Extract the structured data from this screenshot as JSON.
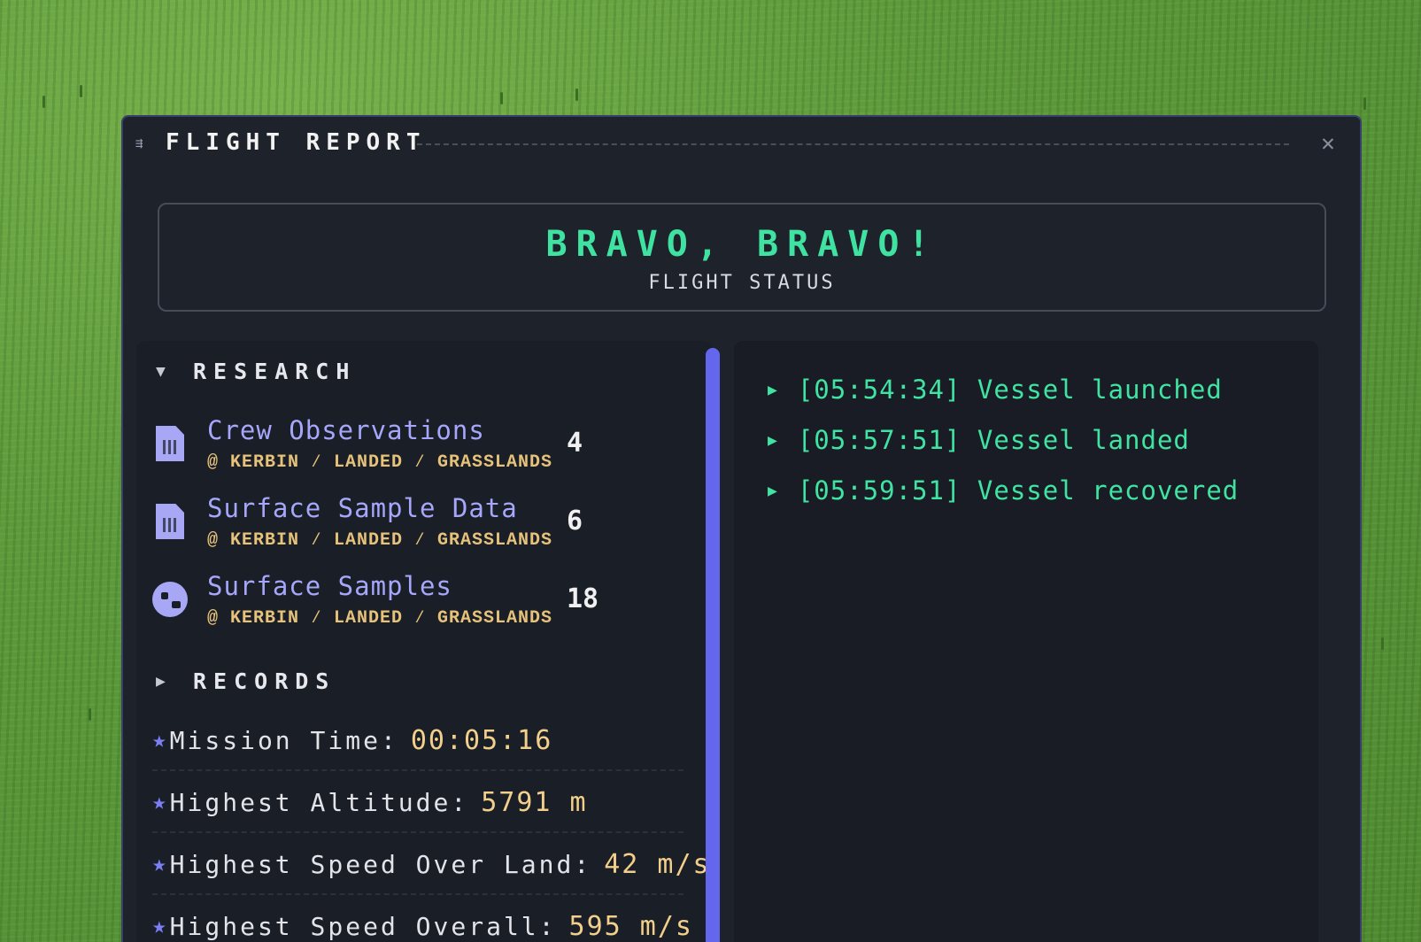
{
  "window": {
    "title": "FLIGHT REPORT"
  },
  "status": {
    "headline": "BRAVO, BRAVO!",
    "subtitle": "FLIGHT STATUS"
  },
  "research": {
    "heading": "RESEARCH",
    "items": [
      {
        "title": "Crew Observations",
        "location": "@ KERBIN ⁄ LANDED ⁄ GRASSLANDS",
        "count": "4",
        "icon": "document-icon"
      },
      {
        "title": "Surface Sample Data",
        "location": "@ KERBIN ⁄ LANDED ⁄ GRASSLANDS",
        "count": "6",
        "icon": "document-icon"
      },
      {
        "title": "Surface Samples",
        "location": "@ KERBIN ⁄ LANDED ⁄ GRASSLANDS",
        "count": "18",
        "icon": "rock-sample-icon"
      }
    ]
  },
  "records": {
    "heading": "RECORDS",
    "items": [
      {
        "label": "Mission Time:",
        "value": "00:05:16"
      },
      {
        "label": "Highest Altitude:",
        "value": "5791 m"
      },
      {
        "label": "Highest Speed Over Land:",
        "value": "42 m/s"
      },
      {
        "label": "Highest Speed Overall:",
        "value": "595 m/s"
      }
    ]
  },
  "log": {
    "entries": [
      "[05:54:34] Vessel launched",
      "[05:57:51] Vessel landed",
      "[05:59:51] Vessel recovered"
    ]
  },
  "colors": {
    "accent_green": "#40e3a2",
    "accent_purple": "#a6a6fb",
    "location_gold": "#e6c27a",
    "scrollbar": "#6467ee"
  }
}
